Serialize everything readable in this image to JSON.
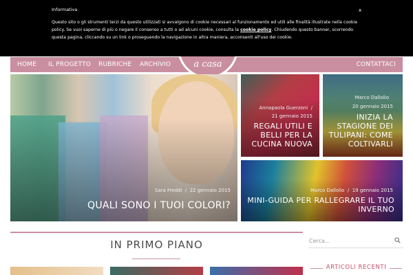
{
  "cookie": {
    "title": "Informativa",
    "close": "x",
    "text_before_link": "Questo sito o gli strumenti terzi da questo utilizzati si avvalgono di cookie necessari al funzionamento ed utili alle finalità illustrate nella cookie policy. Se vuoi saperne di più o negare il consenso a tutti o ad alcuni cookie, consulta la ",
    "link": "cookie policy",
    "text_after_link": ". Chiudendo questo banner, scorrendo questa pagina, cliccando su un link o proseguendo la navigazione in altra maniera, acconsenti all'uso dei cookie."
  },
  "logo": {
    "text": "a casa"
  },
  "nav": {
    "items": [
      "HOME",
      "IL PROGETTO",
      "RUBRICHE",
      "ARCHIVIO"
    ],
    "contact": "CONTATTACI"
  },
  "featured": {
    "main": {
      "author": "Sara Freddi",
      "date": "22 gennaio 2015",
      "title": "QUALI SONO I TUOI COLORI?"
    },
    "top_left": {
      "author": "Annapaola Guerzoni",
      "date": "21 gennaio 2015",
      "title_lines": [
        "REGALI UTILI E",
        "BELLI PER LA",
        "CUCINA NUOVA"
      ]
    },
    "top_right": {
      "author": "Marco Dallolio",
      "date": "20 gennaio 2015",
      "title_lines": [
        "INIZIA LA",
        "STAGIONE DEI",
        "TULIPANI: COME",
        "COLTIVARLI"
      ]
    },
    "bottom": {
      "author": "Marco Dallolio",
      "date": "19 gennaio 2015",
      "title_lines": [
        "MINI-GUIDA PER RALLEGRARE IL TUO",
        "INVERNO"
      ]
    }
  },
  "section": {
    "title": "IN PRIMO PIANO"
  },
  "sidebar": {
    "search_placeholder": "Cerca...",
    "widget_title": "ARTICOLI RECENTI"
  },
  "colors": {
    "accent": "#c98fa0",
    "accent_dark": "#c04f6a",
    "banner": "#000000"
  },
  "icons": {
    "search": "search-icon",
    "close": "close-icon"
  }
}
